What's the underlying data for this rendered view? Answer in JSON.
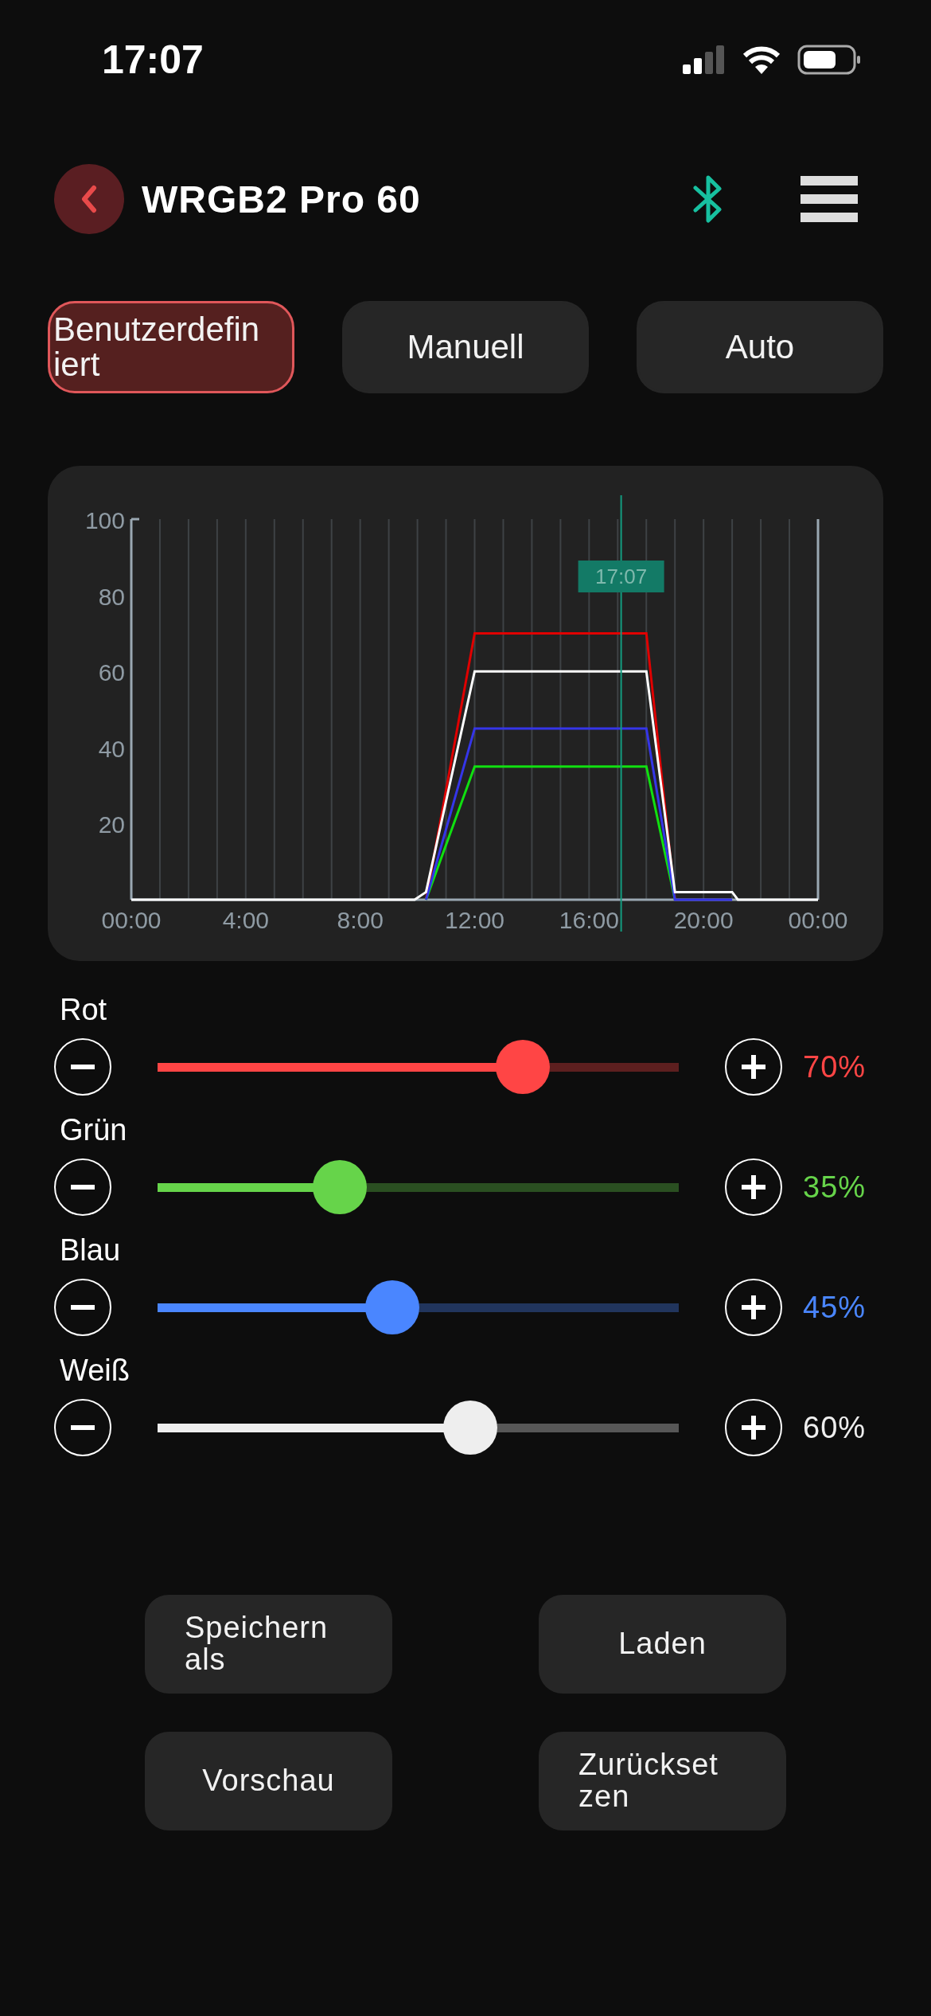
{
  "status_bar": {
    "time": "17:07"
  },
  "header": {
    "title": "WRGB2 Pro 60"
  },
  "tabs": [
    {
      "label": "Benutzerdefiniert",
      "selected": true
    },
    {
      "label": "Manuell",
      "selected": false
    },
    {
      "label": "Auto",
      "selected": false
    }
  ],
  "schedule": {
    "chart_data": {
      "type": "line",
      "x": [
        0,
        9.9,
        10.3,
        12,
        18,
        19,
        21,
        21.2,
        24
      ],
      "series": [
        {
          "color": "#e00000",
          "values": [
            null,
            null,
            0,
            70,
            70,
            0,
            null,
            null,
            null
          ]
        },
        {
          "color": "#10e010",
          "values": [
            null,
            null,
            0,
            35,
            35,
            0,
            null,
            null,
            null
          ]
        },
        {
          "color": "#3535e8",
          "values": [
            null,
            null,
            0,
            45,
            45,
            0,
            0,
            null,
            null
          ]
        },
        {
          "color": "#ffffff",
          "values": [
            0,
            0,
            2,
            60,
            60,
            2,
            2,
            0,
            0
          ]
        }
      ],
      "grid": true,
      "xlim": [
        0,
        24
      ],
      "ylim": [
        0,
        100
      ],
      "xticks": [
        {
          "value": 0,
          "label": "00:00"
        },
        {
          "value": 4,
          "label": "4:00"
        },
        {
          "value": 8,
          "label": "8:00"
        },
        {
          "value": 12,
          "label": "12:00"
        },
        {
          "value": 16,
          "label": "16:00"
        },
        {
          "value": 20,
          "label": "20:00"
        },
        {
          "value": 24,
          "label": "00:00"
        }
      ],
      "yticks": [
        20,
        40,
        60,
        80,
        100
      ],
      "ref_lines": [
        {
          "axis": "x",
          "value": 17.12,
          "label": "17:07"
        }
      ]
    }
  },
  "channels": [
    {
      "name": "Rot",
      "color": "#ff4545",
      "level": 0.7,
      "reading": "70%"
    },
    {
      "name": "Grün",
      "color": "#66d44a",
      "level": 0.35,
      "reading": "35%"
    },
    {
      "name": "Blau",
      "color": "#4a86ff",
      "level": 0.45,
      "reading": "45%"
    },
    {
      "name": "Weiß",
      "color": "#eeeeee",
      "level": 0.6,
      "reading": "60%"
    }
  ],
  "buttons": [
    "Speichern als",
    "Laden",
    "Vorschau",
    "Zurücksetzen"
  ]
}
